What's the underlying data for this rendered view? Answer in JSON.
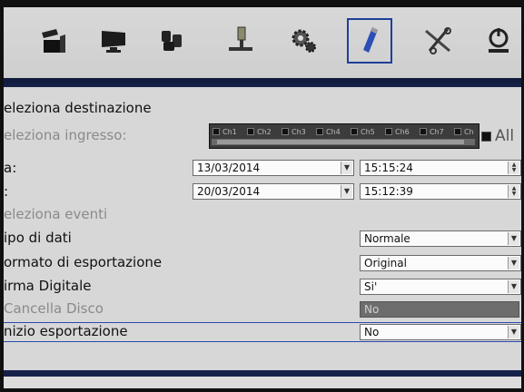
{
  "toolbar": {
    "items": [
      {
        "icon": "clapperboard-icon"
      },
      {
        "icon": "monitor-icon"
      },
      {
        "icon": "camera-group-icon"
      },
      {
        "icon": "network-icon"
      },
      {
        "icon": "gears-icon"
      },
      {
        "icon": "usb-drive-icon",
        "selected": true
      },
      {
        "icon": "tools-icon"
      },
      {
        "icon": "power-icon"
      }
    ]
  },
  "form": {
    "title": "eleziona destinazione",
    "input_label": "eleziona ingresso:",
    "channels": [
      "Ch1",
      "Ch2",
      "Ch3",
      "Ch4",
      "Ch5",
      "Ch6",
      "Ch7",
      "Ch"
    ],
    "all_label": "All",
    "from_label": "a:",
    "from_date": "13/03/2014",
    "from_time": "15:15:24",
    "to_label": ":",
    "to_date": "20/03/2014",
    "to_time": "15:12:39",
    "events_label": "eleziona eventi",
    "data_type_label": "ipo di dati",
    "data_type_value": "Normale",
    "export_format_label": "ormato di esportazione",
    "export_format_value": "Original",
    "signature_label": "irma Digitale",
    "signature_value": "Si'",
    "erase_disk_label": "Cancella Disco",
    "erase_disk_value": "No",
    "start_export_label": "nizio esportazione",
    "start_export_value": "No"
  },
  "colors": {
    "accent": "#1f3f9a",
    "bar": "#16214a"
  }
}
